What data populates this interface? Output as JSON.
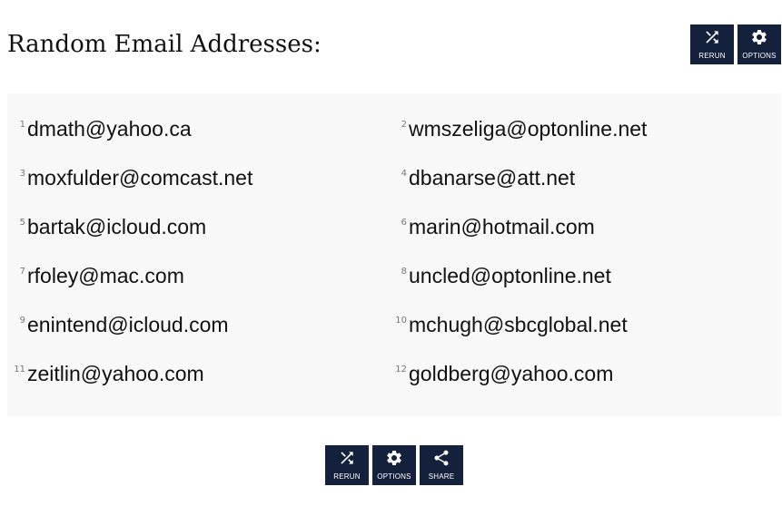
{
  "page": {
    "title": "Random Email Addresses:"
  },
  "top_actions": [
    {
      "label": "RERUN",
      "icon": "shuffle-icon"
    },
    {
      "label": "OPTIONS",
      "icon": "gear-icon"
    }
  ],
  "emails": [
    {
      "number": "1",
      "address": "dmath@yahoo.ca"
    },
    {
      "number": "2",
      "address": "wmszeliga@optonline.net"
    },
    {
      "number": "3",
      "address": "moxfulder@comcast.net"
    },
    {
      "number": "4",
      "address": "dbanarse@att.net"
    },
    {
      "number": "5",
      "address": "bartak@icloud.com"
    },
    {
      "number": "6",
      "address": "marin@hotmail.com"
    },
    {
      "number": "7",
      "address": "rfoley@mac.com"
    },
    {
      "number": "8",
      "address": "uncled@optonline.net"
    },
    {
      "number": "9",
      "address": "enintend@icloud.com"
    },
    {
      "number": "10",
      "address": "mchugh@sbcglobal.net"
    },
    {
      "number": "11",
      "address": "zeitlin@yahoo.com"
    },
    {
      "number": "12",
      "address": "goldberg@yahoo.com"
    }
  ],
  "bottom_actions": [
    {
      "label": "RERUN",
      "icon": "shuffle-icon"
    },
    {
      "label": "OPTIONS",
      "icon": "gear-icon"
    },
    {
      "label": "SHARE",
      "icon": "share-icon"
    }
  ],
  "colors": {
    "button_bg": "#14213d",
    "panel_bg": "#f8f8f8",
    "text": "#111111"
  }
}
